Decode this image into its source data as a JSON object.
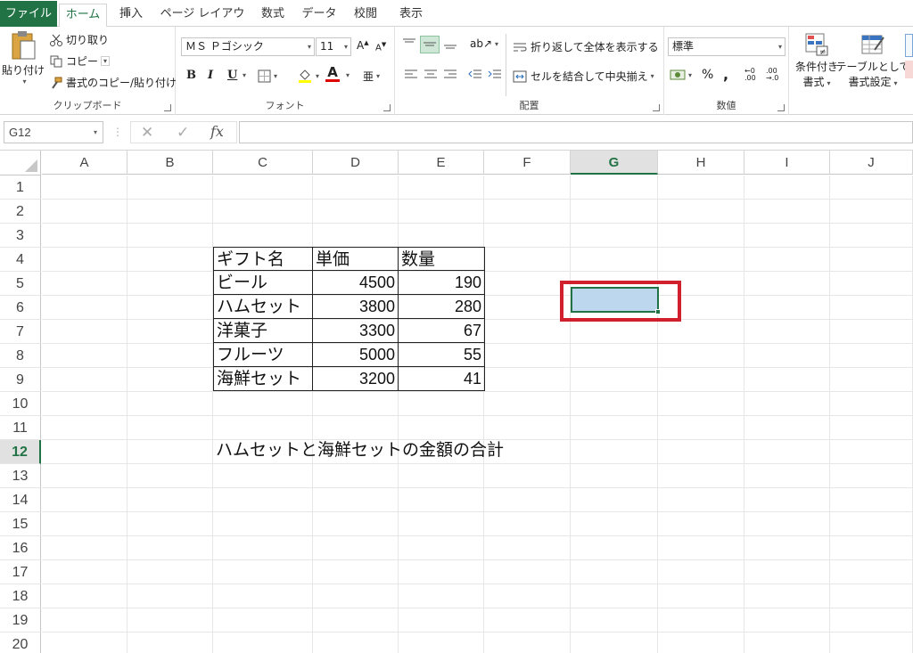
{
  "tabs": [
    "ファイル",
    "ホーム",
    "挿入",
    "ページ レイアウト",
    "数式",
    "データ",
    "校閲",
    "表示"
  ],
  "clipboard": {
    "paste": "貼り付け",
    "cut": "切り取り",
    "copy": "コピー",
    "format_painter": "書式のコピー/貼り付け",
    "label": "クリップボード"
  },
  "font": {
    "name": "ＭＳ Ｐゴシック",
    "size": "11",
    "bold": "B",
    "italic": "I",
    "underline": "U",
    "font_color_glyph": "A",
    "label": "フォント"
  },
  "alignment": {
    "wrap_text": "折り返して全体を表示する",
    "merge_center": "セルを結合して中央揃え",
    "label": "配置"
  },
  "number": {
    "format": "標準",
    "percent": "%",
    "comma": ",",
    "label": "数値"
  },
  "styles": {
    "conditional_1": "条件付き",
    "conditional_2": "書式",
    "table_1": "テーブルとして",
    "table_2": "書式設定"
  },
  "formula_bar": {
    "name_box": "G12",
    "fx": "fx",
    "value": ""
  },
  "grid": {
    "columns": [
      "A",
      "B",
      "C",
      "D",
      "E",
      "F",
      "G",
      "H",
      "I",
      "J"
    ],
    "selected_column": "G",
    "rows": [
      "1",
      "2",
      "3",
      "4",
      "5",
      "6",
      "7",
      "8",
      "9",
      "10",
      "11",
      "12",
      "13",
      "14",
      "15",
      "16",
      "17",
      "18",
      "19",
      "20"
    ],
    "selected_row": "12"
  },
  "table": {
    "headers": [
      "ギフト名",
      "単価",
      "数量"
    ],
    "rows": [
      [
        "ビール",
        "4500",
        "190"
      ],
      [
        "ハムセット",
        "3800",
        "280"
      ],
      [
        "洋菓子",
        "3300",
        "67"
      ],
      [
        "フルーツ",
        "5000",
        "55"
      ],
      [
        "海鮮セット",
        "3200",
        "41"
      ]
    ]
  },
  "question": "ハムセットと海鮮セットの金額の合計",
  "colors": {
    "accent": "#217346",
    "selection_fill": "#bdd7ee",
    "highlight_box": "#d01f2d"
  }
}
